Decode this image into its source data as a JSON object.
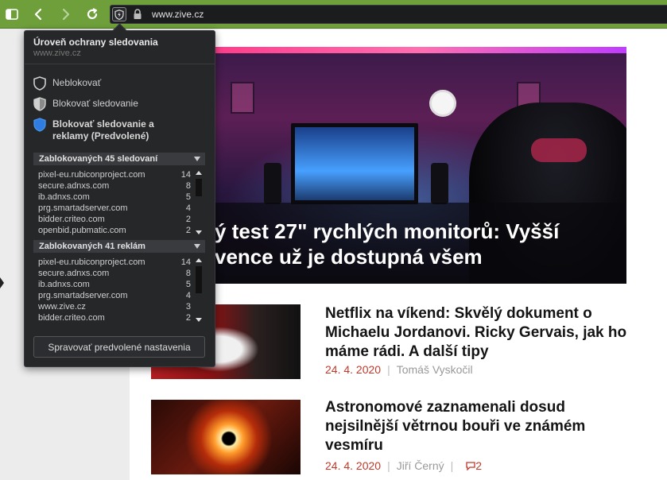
{
  "browser": {
    "url": "www.zive.cz",
    "icons": [
      "sidebar-icon",
      "back-icon",
      "forward-icon",
      "reload-icon",
      "shield-icon",
      "lock-icon"
    ],
    "accent": "#6e9f3a"
  },
  "popup": {
    "title": "Úroveň ochrany sledovania",
    "site": "www.zive.cz",
    "options": [
      {
        "label": "Neblokovať",
        "selected": false
      },
      {
        "label": "Blokovať sledovanie",
        "selected": false
      },
      {
        "label": "Blokovať sledovanie a reklamy (Predvolené)",
        "selected": true
      }
    ],
    "trackers": {
      "header": "Zablokovaných 45 sledovaní",
      "rows": [
        {
          "domain": "pixel-eu.rubiconproject.com",
          "count": "14"
        },
        {
          "domain": "secure.adnxs.com",
          "count": "8"
        },
        {
          "domain": "ib.adnxs.com",
          "count": "5"
        },
        {
          "domain": "prg.smartadserver.com",
          "count": "4"
        },
        {
          "domain": "bidder.criteo.com",
          "count": "2"
        },
        {
          "domain": "openbid.pubmatic.com",
          "count": "2"
        }
      ]
    },
    "ads": {
      "header": "Zablokovaných 41 reklám",
      "rows": [
        {
          "domain": "pixel-eu.rubiconproject.com",
          "count": "14"
        },
        {
          "domain": "secure.adnxs.com",
          "count": "8"
        },
        {
          "domain": "ib.adnxs.com",
          "count": "5"
        },
        {
          "domain": "prg.smartadserver.com",
          "count": "4"
        },
        {
          "domain": "www.zive.cz",
          "count": "3"
        },
        {
          "domain": "bidder.criteo.com",
          "count": "2"
        }
      ]
    },
    "manage_button": "Spravovať predvolené nastavenia"
  },
  "page": {
    "hero": {
      "line1": "ý test 27\" rychlých monitorů: Vyšší",
      "line2": "vence už je dostupná všem"
    },
    "articles": [
      {
        "title": "Netflix na víkend: Skvělý dokument o Michaelu Jordanovi. Ricky Gervais, jak ho máme rádi. A další tipy",
        "date": "24. 4. 2020",
        "author": "Tomáš Vyskočil",
        "comments": ""
      },
      {
        "title": "Astronomové zaznamenali dosud nejsilnější větrnou bouři ve známém vesmíru",
        "date": "24. 4. 2020",
        "author": "Jiří Černý",
        "comments": "2"
      }
    ]
  }
}
